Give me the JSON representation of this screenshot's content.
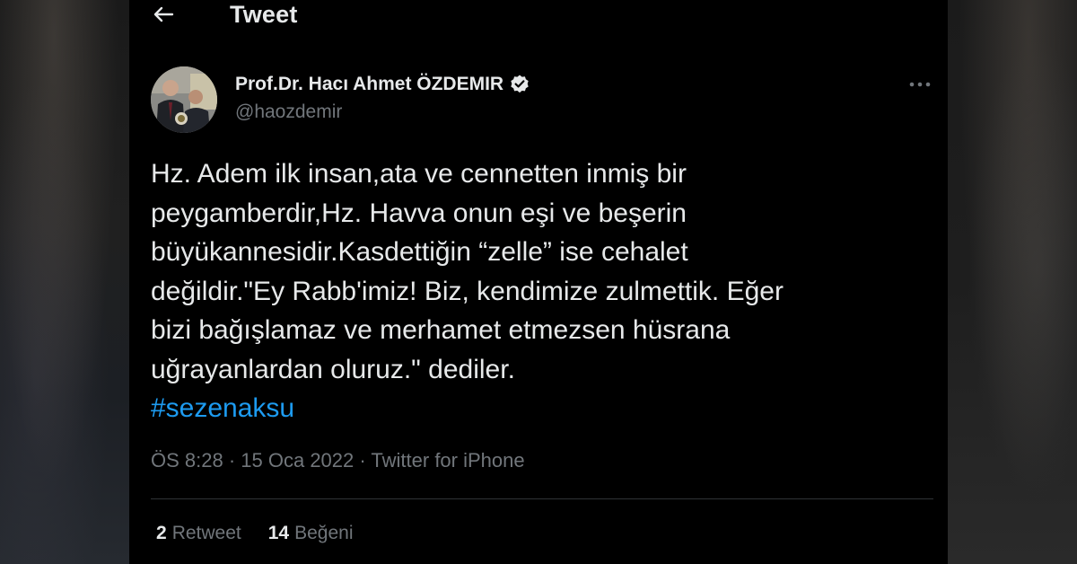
{
  "header": {
    "title": "Tweet",
    "back_icon": "arrow-left-icon"
  },
  "author": {
    "display_name": "Prof.Dr. Hacı Ahmet ÖZDEMIR",
    "handle": "@haozdemir",
    "verified": true,
    "verified_icon": "verified-badge-icon",
    "more_icon": "more-horizontal-icon"
  },
  "tweet": {
    "lines": [
      "Hz. Adem ilk insan,ata ve cennetten inmiş bir",
      "peygamberdir,Hz. Havva onun eşi ve beşerin",
      "büyükannesidir.Kasdettiğin “zelle” ise cehalet",
      "değildir.\"Ey Rabb'imiz! Biz, kendimize zulmettik. Eğer",
      "bizi bağışlamaz ve merhamet etmezsen hüsrana",
      "uğrayanlardan oluruz.\" dediler."
    ],
    "hashtag": "#sezenaksu"
  },
  "meta": {
    "time": "ÖS 8:28",
    "separator": " · ",
    "date": "15 Oca 2022",
    "source": "Twitter for iPhone"
  },
  "stats": {
    "retweets_count": "2",
    "retweets_label": "Retweet",
    "likes_count": "14",
    "likes_label": "Beğeni"
  },
  "colors": {
    "background": "#000000",
    "text": "#e7e9ea",
    "secondary_text": "#71767b",
    "accent": "#1d9bf0",
    "divider": "#2f3336"
  }
}
